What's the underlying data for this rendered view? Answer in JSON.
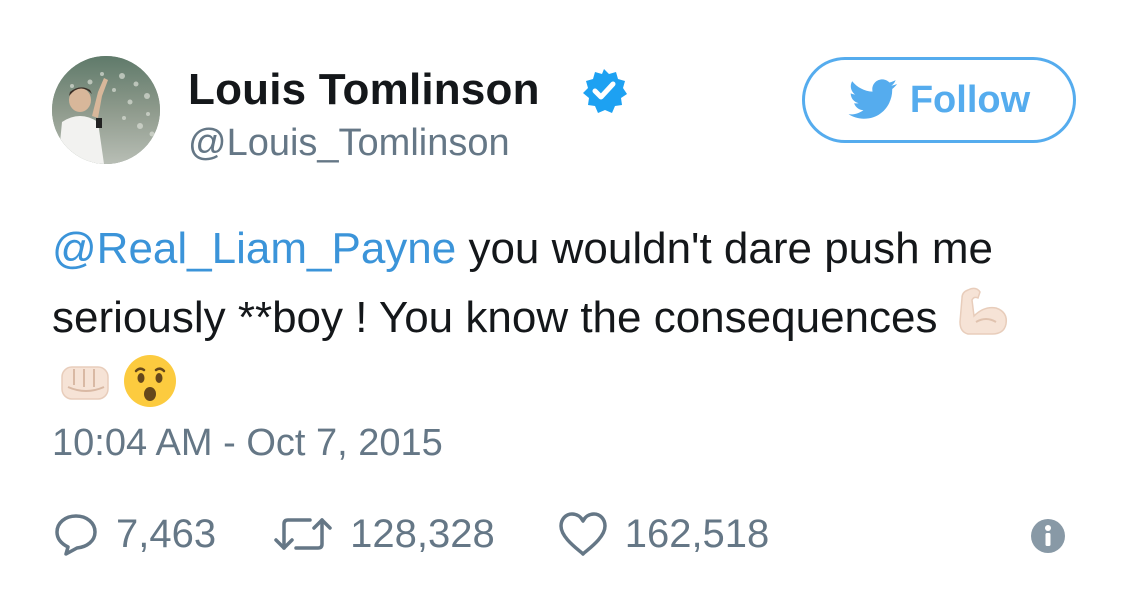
{
  "author": {
    "name": "Louis Tomlinson",
    "handle": "@Louis_Tomlinson",
    "verified_icon": "verified-badge-icon"
  },
  "follow_button": {
    "label": "Follow",
    "icon": "twitter-bird-icon"
  },
  "tweet": {
    "mention": "@Real_Liam_Payne",
    "text": " you wouldn't dare push me seriously **boy ! You know the consequences",
    "emojis": [
      "flexed-biceps-emoji",
      "fist-emoji",
      "astonished-face-emoji"
    ],
    "timestamp": "10:04 AM - Oct 7, 2015"
  },
  "actions": {
    "replies": "7,463",
    "retweets": "128,328",
    "likes": "162,518"
  },
  "colors": {
    "accent": "#55acee",
    "link": "#3b94d9",
    "secondary_text": "#657786",
    "primary_text": "#14171a"
  }
}
